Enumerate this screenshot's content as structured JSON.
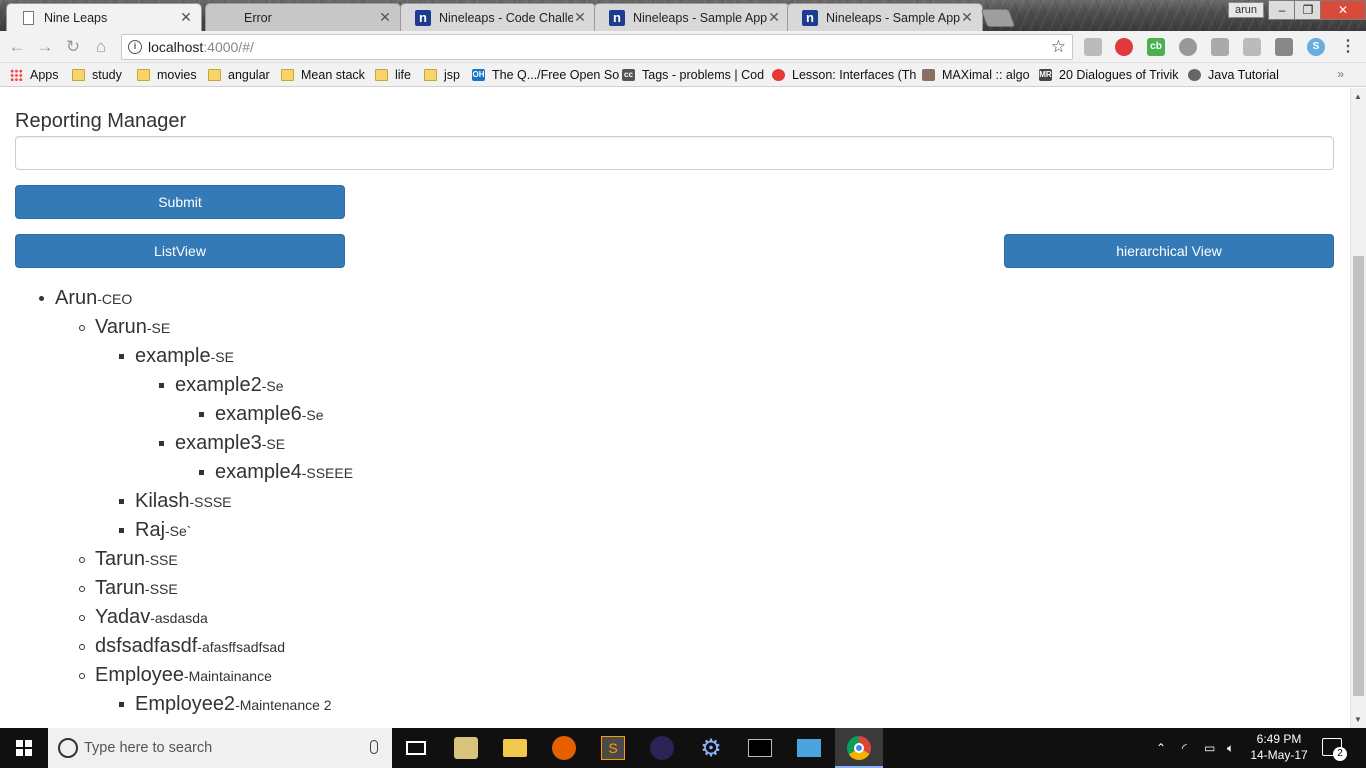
{
  "browser": {
    "tabs": [
      {
        "title": "Nine Leaps",
        "icon": "page-icon",
        "state": "active"
      },
      {
        "title": "Error",
        "icon": "page-icon",
        "state": "inactive"
      },
      {
        "title": "Nineleaps - Code Challe",
        "icon": "nineleaps-icon",
        "state": "inactive"
      },
      {
        "title": "Nineleaps - Sample App",
        "icon": "nineleaps-icon",
        "state": "inactive"
      },
      {
        "title": "Nineleaps - Sample App",
        "icon": "nineleaps-icon",
        "state": "inactive"
      }
    ],
    "profile_name": "arun",
    "url_host": "localhost",
    "url_path": ":4000/#/",
    "bookmarks": [
      {
        "label": "Apps",
        "type": "apps"
      },
      {
        "label": "study",
        "type": "folder"
      },
      {
        "label": "movies",
        "type": "folder"
      },
      {
        "label": "angular",
        "type": "folder"
      },
      {
        "label": "Mean stack",
        "type": "folder"
      },
      {
        "label": "life",
        "type": "folder"
      },
      {
        "label": "jsp",
        "type": "folder"
      },
      {
        "label": "The Q.../Free Open So",
        "type": "link"
      },
      {
        "label": "Tags - problems | Cod",
        "type": "link"
      },
      {
        "label": "Lesson: Interfaces (Th",
        "type": "link"
      },
      {
        "label": "MAXimal :: algo",
        "type": "link"
      },
      {
        "label": "20 Dialogues of Trivik",
        "type": "link"
      },
      {
        "label": "Java Tutorial",
        "type": "link"
      }
    ],
    "bookmarks_more": "»"
  },
  "form": {
    "reporting_manager_label": "Reporting Manager",
    "reporting_manager_value": "",
    "submit_label": "Submit",
    "list_view_label": "ListView",
    "hierarchical_view_label": "hierarchical View"
  },
  "tree": [
    {
      "name": "Arun",
      "role": "-CEO",
      "depth": 0
    },
    {
      "name": "Varun",
      "role": "-SE",
      "depth": 1
    },
    {
      "name": "example",
      "role": "-SE",
      "depth": 2
    },
    {
      "name": "example2",
      "role": "-Se",
      "depth": 3
    },
    {
      "name": "example6",
      "role": "-Se",
      "depth": 4
    },
    {
      "name": "example3",
      "role": "-SE",
      "depth": 3
    },
    {
      "name": "example4",
      "role": "-SSEEE",
      "depth": 4
    },
    {
      "name": "Kilash",
      "role": "-SSSE",
      "depth": 2
    },
    {
      "name": "Raj",
      "role": "-Se`",
      "depth": 2
    },
    {
      "name": "Tarun",
      "role": "-SSE",
      "depth": 1
    },
    {
      "name": "Tarun",
      "role": "-SSE",
      "depth": 1
    },
    {
      "name": "Yadav",
      "role": "-asdasda",
      "depth": 1
    },
    {
      "name": "dsfsadfasdf",
      "role": "-afasffsadfsad",
      "depth": 1
    },
    {
      "name": "Employee",
      "role": "-Maintainance",
      "depth": 1
    },
    {
      "name": "Employee2",
      "role": "-Maintenance 2",
      "depth": 2
    }
  ],
  "taskbar": {
    "search_placeholder": "Type here to search",
    "time": "6:49 PM",
    "date": "14-May-17",
    "notification_count": "2"
  },
  "colors": {
    "primary_button": "#337ab7",
    "text": "#333333"
  }
}
